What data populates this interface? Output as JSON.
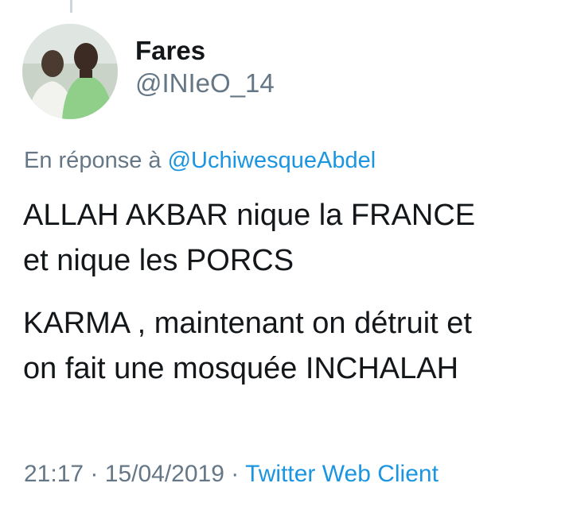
{
  "user": {
    "display_name": "Fares",
    "handle": "@INIeO_14"
  },
  "reply": {
    "prefix": "En réponse à",
    "mention": "@UchiwesqueAbdel"
  },
  "tweet": {
    "paragraphs": [
      {
        "lines": [
          "ALLAH AKBAR nique la FRANCE",
          "et nique les PORCS"
        ]
      },
      {
        "lines": [
          "KARMA , maintenant on détruit et",
          "on fait une mosquée INCHALAH"
        ]
      }
    ]
  },
  "meta": {
    "time": "21:17",
    "separator": "·",
    "date": "15/04/2019",
    "client": "Twitter Web Client"
  },
  "colors": {
    "text": "#14171a",
    "secondary": "#657786",
    "link": "#1b95e0"
  },
  "icons": {
    "avatar": "profile-photo-avatar"
  }
}
